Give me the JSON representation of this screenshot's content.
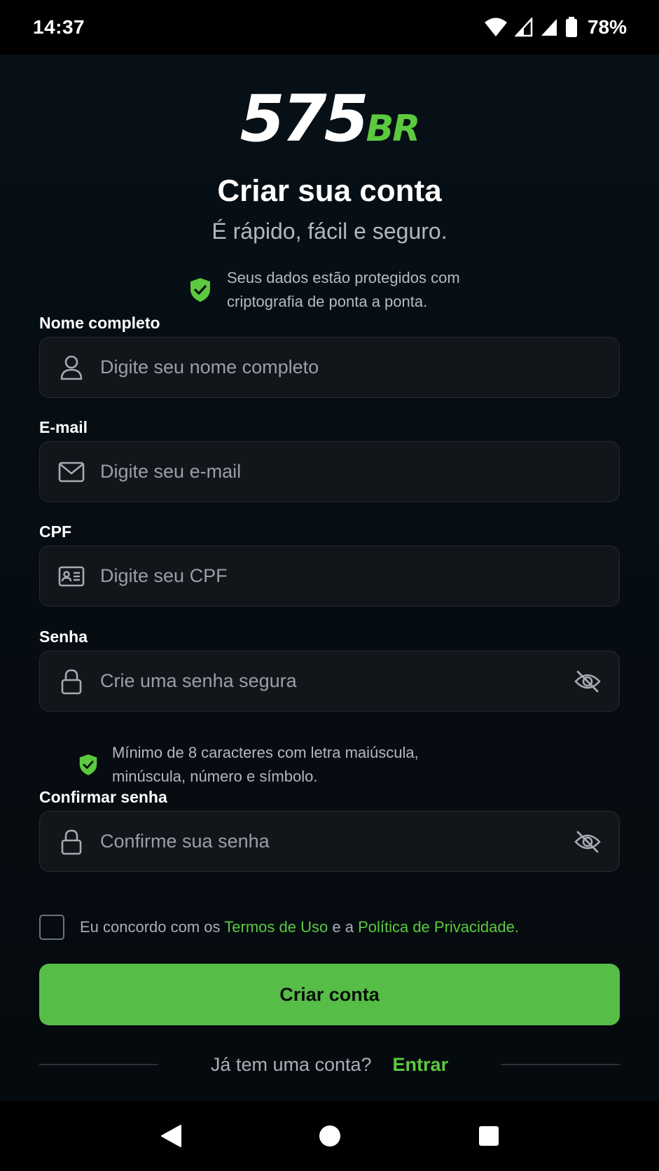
{
  "status_bar": {
    "time": "14:37",
    "battery": "78%"
  },
  "brand": {
    "logo_main": "575",
    "logo_suffix": "BR",
    "accent_color": "#5cc93e"
  },
  "header": {
    "title": "Criar sua conta",
    "subtitle": "É rápido, fácil e seguro.",
    "security_note": "Seus dados estão protegidos com criptografia de ponta a ponta.",
    "security_icon": "shield-check-icon"
  },
  "form": {
    "full_name": {
      "label": "Nome completo",
      "placeholder": "Digite seu nome completo",
      "value": "",
      "icon": "user-icon"
    },
    "email": {
      "label": "E-mail",
      "placeholder": "Digite seu e-mail",
      "value": "",
      "icon": "mail-icon"
    },
    "cpf": {
      "label": "CPF",
      "placeholder": "Digite seu CPF",
      "value": "",
      "icon": "id-card-icon"
    },
    "password": {
      "label": "Senha",
      "placeholder": "Crie uma senha segura",
      "value": "",
      "icon": "lock-icon",
      "toggle_icon": "eye-off-icon"
    },
    "password_hint": "Mínimo de 8 caracteres com letra maiúscula, minúscula, número e símbolo.",
    "confirm_password": {
      "label": "Confirmar senha",
      "placeholder": "Confirme sua senha",
      "value": "",
      "icon": "lock-icon",
      "toggle_icon": "eye-off-icon"
    }
  },
  "terms": {
    "checked": false,
    "prefix": "Eu concordo com os",
    "terms_link": "Termos de Uso",
    "connector": "e a",
    "privacy_link": "Política de Privacidade",
    "suffix": "."
  },
  "submit_label": "Criar conta",
  "login": {
    "question": "Já tem uma conta?",
    "link": "Entrar"
  },
  "navigation": {
    "back_icon": "back-triangle-icon",
    "home_icon": "home-circle-icon",
    "recents_icon": "recents-square-icon"
  }
}
